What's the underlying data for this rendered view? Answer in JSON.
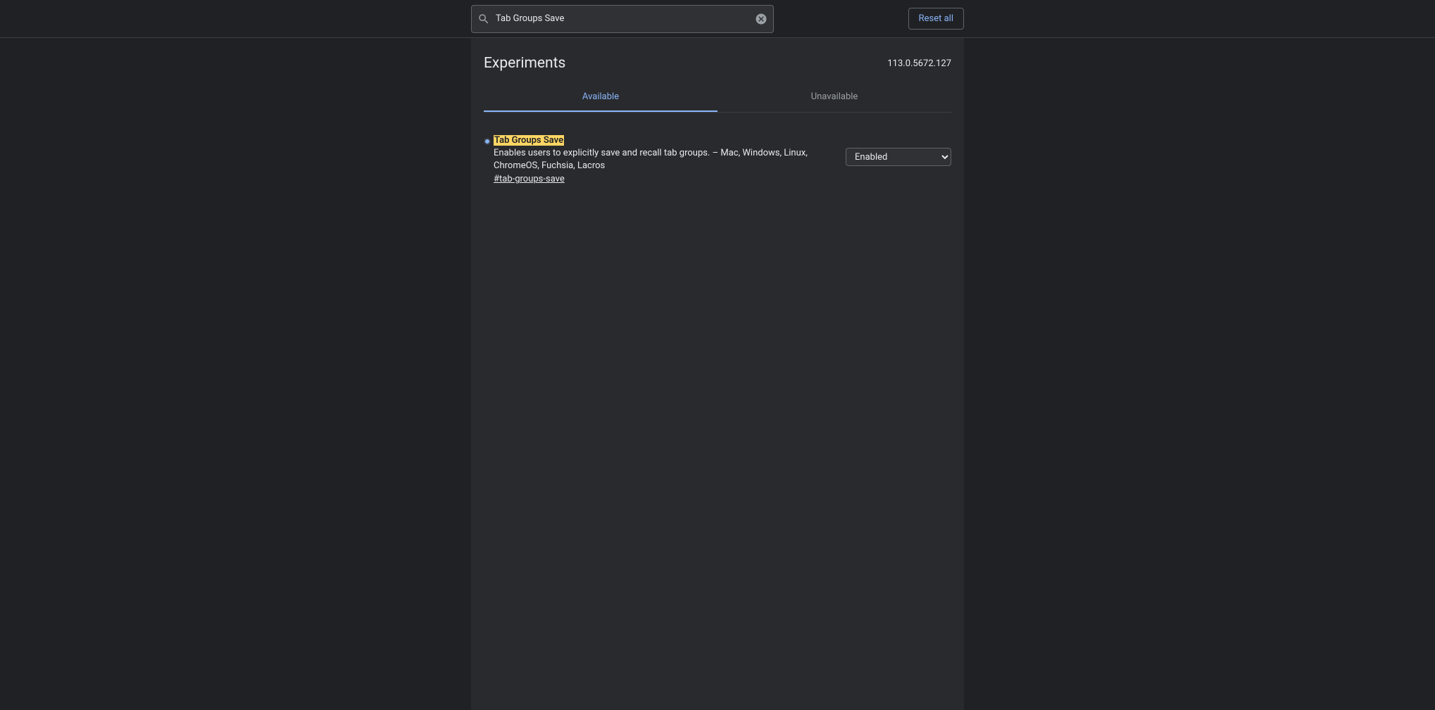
{
  "header": {
    "search_value": "Tab Groups Save",
    "reset_label": "Reset all"
  },
  "page": {
    "title": "Experiments",
    "version": "113.0.5672.127"
  },
  "tabs": {
    "available": "Available",
    "unavailable": "Unavailable"
  },
  "experiment": {
    "title": "Tab Groups Save",
    "description": "Enables users to explicitly save and recall tab groups. – Mac, Windows, Linux, ChromeOS, Fuchsia, Lacros",
    "anchor": "#tab-groups-save",
    "selected_value": "Enabled"
  }
}
